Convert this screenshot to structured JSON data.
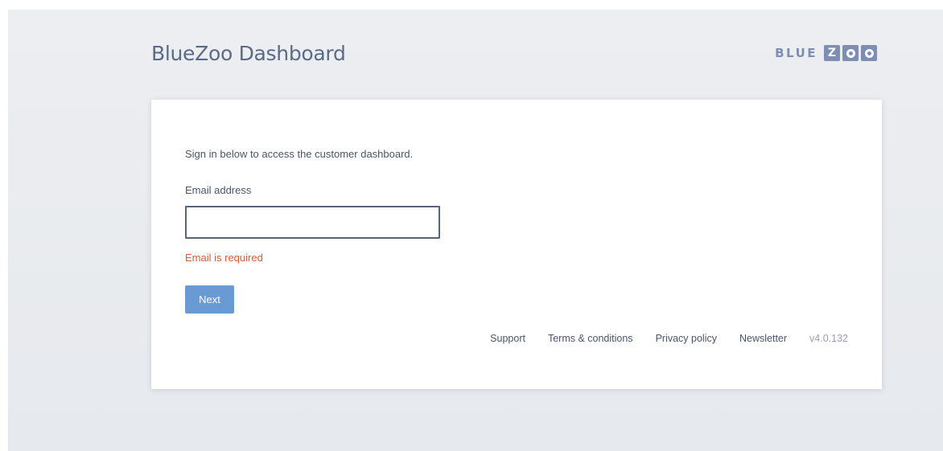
{
  "header": {
    "title": "BlueZoo Dashboard",
    "logo": {
      "text": "BLUE",
      "letter_z": "Z"
    }
  },
  "login": {
    "intro": "Sign in below to access the customer dashboard.",
    "email_label": "Email address",
    "email_value": "",
    "email_placeholder": "",
    "error": "Email is required",
    "next_label": "Next"
  },
  "footer": {
    "support": "Support",
    "terms": "Terms & conditions",
    "privacy": "Privacy policy",
    "newsletter": "Newsletter",
    "version": "v4.0.132"
  },
  "colors": {
    "title": "#5b6a86",
    "logo": "#7d8db4",
    "error": "#e0592f",
    "button": "#6a9ad4",
    "background": "#e8eaee"
  },
  "icons": [
    "logo-mark"
  ]
}
